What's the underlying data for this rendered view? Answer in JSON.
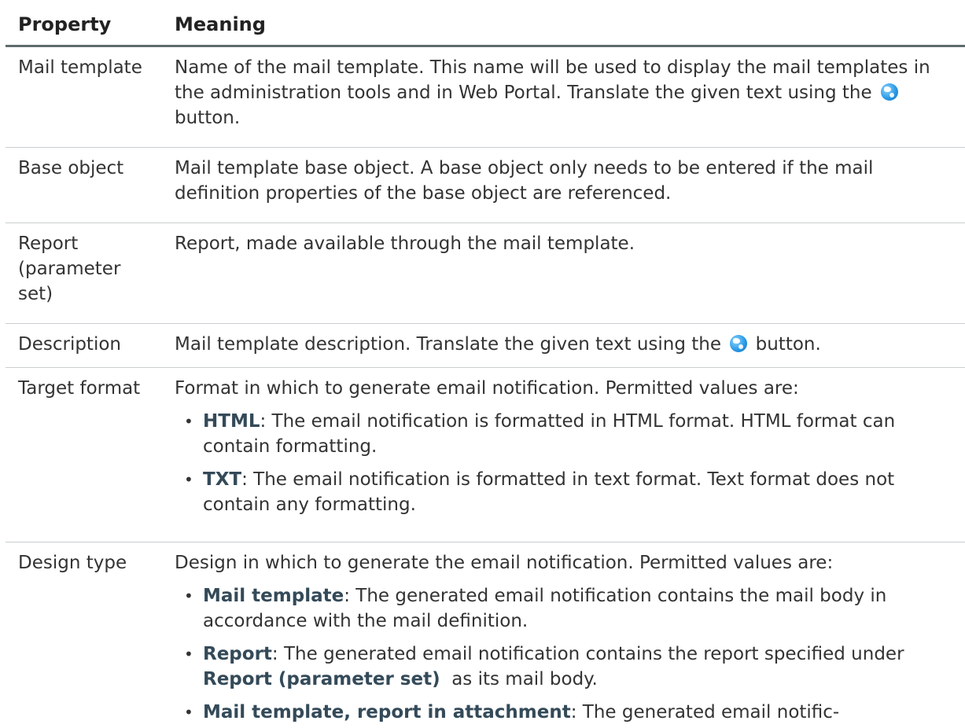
{
  "header": {
    "property": "Property",
    "meaning": "Meaning"
  },
  "rows": {
    "mail_template": {
      "property": "Mail template",
      "text_before_icon": "Name of the mail template. This name will be used to display the mail templates in the administration tools and in Web Portal. Translate the given text using the ",
      "icon": "globe-translate-icon",
      "text_after_icon": " button."
    },
    "base_object": {
      "property": "Base object",
      "text": "Mail template base object. A base object only needs to be entered if the mail definition properties of the base object are referenced."
    },
    "report": {
      "property_line1": "Report",
      "property_line2": "(parameter",
      "property_line3": "set)",
      "text": "Report, made available through the mail template."
    },
    "description": {
      "property": "Description",
      "text_before_icon": "Mail template description. Translate the given text using the ",
      "icon": "globe-translate-icon",
      "text_after_icon": " button."
    },
    "target_format": {
      "property": "Target format",
      "intro": "Format in which to generate email notification. Permitted values are:",
      "bullets": [
        {
          "term": "HTML",
          "text": ": The email notification is formatted in HTML format. HTML format can contain formatting."
        },
        {
          "term": "TXT",
          "text": ": The email notification is formatted in text format. Text format does not contain any formatting."
        }
      ]
    },
    "design_type": {
      "property": "Design type",
      "intro": "Design in which to generate the email notification. Permitted values are:",
      "bullets": [
        {
          "term": "Mail template",
          "text": ": The generated email notification contains the mail body in accordance with the mail definition."
        },
        {
          "term": "Report",
          "text_before_ref": ": The generated email notification contains the report specified under ",
          "ref": "Report (parameter set)",
          "text_after_ref": "  as its mail body."
        },
        {
          "term": "Mail template, report in attachment",
          "text": ": The generated email notific-"
        }
      ]
    }
  },
  "colors": {
    "header_rule": "#5f6b6d",
    "row_rule": "#c9ced0",
    "term_text": "#344a59",
    "body_text": "#333333",
    "icon_blue": "#2b9be6"
  }
}
